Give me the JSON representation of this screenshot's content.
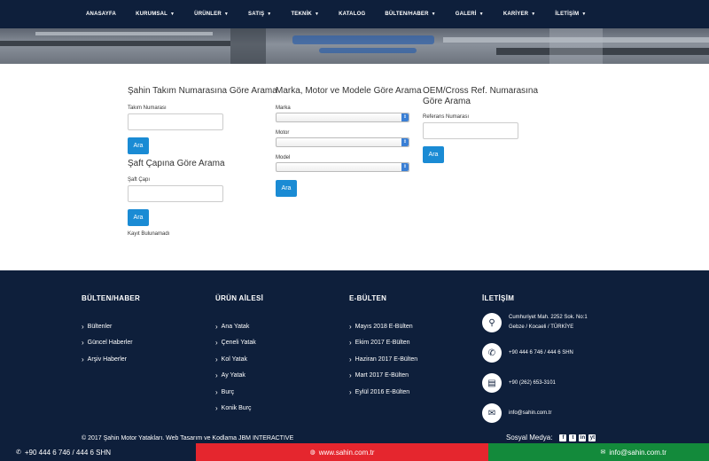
{
  "nav": {
    "items": [
      {
        "label": "ANASAYFA",
        "caret": false
      },
      {
        "label": "KURUMSAL",
        "caret": true
      },
      {
        "label": "ÜRÜNLER",
        "caret": true
      },
      {
        "label": "SATIŞ",
        "caret": true
      },
      {
        "label": "TEKNİK",
        "caret": true
      },
      {
        "label": "KATALOG",
        "caret": false
      },
      {
        "label": "BÜLTEN/HABER",
        "caret": true
      },
      {
        "label": "GALERİ",
        "caret": true
      },
      {
        "label": "KARİYER",
        "caret": true
      },
      {
        "label": "İLETİŞİM",
        "caret": true
      }
    ]
  },
  "search": {
    "takim": {
      "title": "Şahin Takım Numarasına Göre Arama",
      "label": "Takım Numarası",
      "value": "",
      "button": "Ara"
    },
    "saft": {
      "title": "Şaft Çapına Göre Arama",
      "label": "Şaft Çapı",
      "value": "",
      "button": "Ara",
      "note": "Kayıt Bulunamadı"
    },
    "marka": {
      "title": "Marka, Motor ve Modele Göre Arama",
      "marka_label": "Marka",
      "motor_label": "Motor",
      "model_label": "Model",
      "marka_value": "",
      "motor_value": "",
      "model_value": "",
      "button": "Ara"
    },
    "oem": {
      "title": "OEM/Cross Ref. Numarasına Göre Arama",
      "label": "Referans Numarası",
      "value": "",
      "button": "Ara"
    }
  },
  "footer": {
    "bulten": {
      "title": "BÜLTEN/HABER",
      "links": [
        "Bültenler",
        "Güncel Haberler",
        "Arşiv Haberler"
      ]
    },
    "urun": {
      "title": "ÜRÜN AİLESİ",
      "links": [
        "Ana Yatak",
        "Çeneli Yatak",
        "Kol Yatak",
        "Ay Yatak",
        "Burç",
        "Konik Burç"
      ]
    },
    "ebulten": {
      "title": "E-BÜLTEN",
      "links": [
        "Mayıs 2018 E-Bülten",
        "Ekim 2017 E-Bülten",
        "Haziran 2017 E-Bülten",
        "Mart 2017 E-Bülten",
        "Eylül 2016 E-Bülten"
      ]
    },
    "iletisim": {
      "title": "İLETİŞİM",
      "address_line1": "Cumhuriyet Mah. 2252 Sok. No:1",
      "address_line2": "Gebze / Kocaeli / TÜRKİYE",
      "phone": "+90 444 6 746 / 444 6 SHN",
      "fax": "+90 (262) 653-3101",
      "email": "info@sahin.com.tr"
    },
    "copyright": "© 2017 Şahin Motor Yatakları. Web Tasarım ve Kodlama JBM INTERACTIVE",
    "social_label": "Sosyal Medya:",
    "social_icons": [
      "f",
      "t",
      "in",
      "yt"
    ]
  },
  "bottombar": {
    "phone": "+90 444 6 746 / 444 6 SHN",
    "web": "www.sahin.com.tr",
    "email": "info@sahin.com.tr"
  },
  "colors": {
    "navy": "#0e1f3b",
    "button_blue": "#1a8bd4",
    "red": "#e5262e",
    "green": "#138a3b"
  }
}
